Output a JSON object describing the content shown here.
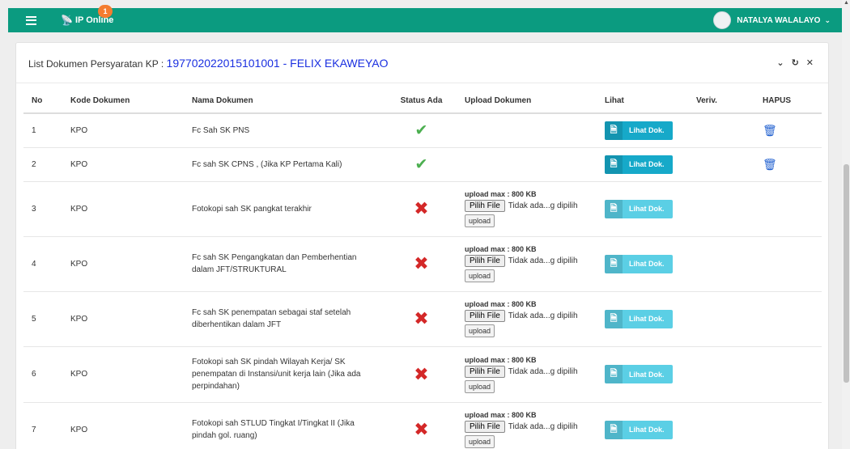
{
  "topbar": {
    "brand": "IP Online",
    "notif_count": "1",
    "user_name": "NATALYA WALALAYO"
  },
  "panel": {
    "title_prefix": "List Dokumen Persyaratan KP :",
    "title_highlight": "197702022015101001 - FELIX EKAWEYAO"
  },
  "table": {
    "headers": [
      "No",
      "Kode Dokumen",
      "Nama Dokumen",
      "Status Ada",
      "Upload Dokumen",
      "Lihat",
      "Veriv.",
      "HAPUS"
    ],
    "upload_max_label": "upload max : 800 KB",
    "file_button": "Pilih File",
    "file_status": "Tidak ada...g dipilih",
    "upload_button": "upload",
    "lihat_label": "Lihat Dok.",
    "rows": [
      {
        "no": "1",
        "kode": "KPO",
        "nama": "Fc Sah SK PNS"
      },
      {
        "no": "2",
        "kode": "KPO",
        "nama": "Fc sah SK CPNS , (Jika KP Pertama Kali)"
      },
      {
        "no": "3",
        "kode": "KPO",
        "nama": "Fotokopi sah SK pangkat terakhir"
      },
      {
        "no": "4",
        "kode": "KPO",
        "nama": "Fc sah SK Pengangkatan dan Pemberhentian dalam JFT/STRUKTURAL"
      },
      {
        "no": "5",
        "kode": "KPO",
        "nama": "Fc sah SK penempatan sebagai staf setelah diberhentikan dalam JFT"
      },
      {
        "no": "6",
        "kode": "KPO",
        "nama": "Fotokopi sah SK pindah Wilayah Kerja/ SK penempatan di Instansi/unit kerja lain (Jika ada perpindahan)"
      },
      {
        "no": "7",
        "kode": "KPO",
        "nama": "Fotokopi sah STLUD Tingkat I/Tingkat II (Jika pindah gol. ruang)"
      }
    ]
  },
  "colors": {
    "topbar": "#0b9b80",
    "highlight": "#1a2fe0",
    "check": "#4caf50",
    "cross": "#d42828",
    "lihat_active": "#16a9c9",
    "lihat_disabled": "#5bcfe5",
    "trash": "#1f5fcf"
  }
}
